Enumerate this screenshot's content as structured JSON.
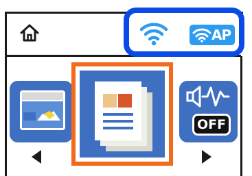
{
  "header": {
    "home_icon": "home-icon",
    "status_icons": {
      "wifi_icon": "wifi-icon",
      "ap_badge_label": "AP"
    }
  },
  "menu": {
    "tiles": [
      {
        "name": "scan",
        "icon": "scan-to-computer-icon"
      },
      {
        "name": "copy",
        "icon": "copy-document-icon",
        "selected": true
      },
      {
        "name": "quiet-mode",
        "icon": "quiet-mode-icon",
        "badge": "OFF"
      }
    ],
    "nav": {
      "left_icon": "arrow-left-icon",
      "right_icon": "arrow-right-icon"
    }
  },
  "colors": {
    "tile_blue": "#3f6fc0",
    "selection_orange": "#f26a1b",
    "highlight_blue": "#0a4be6",
    "ap_blue": "#2d9bf0"
  }
}
